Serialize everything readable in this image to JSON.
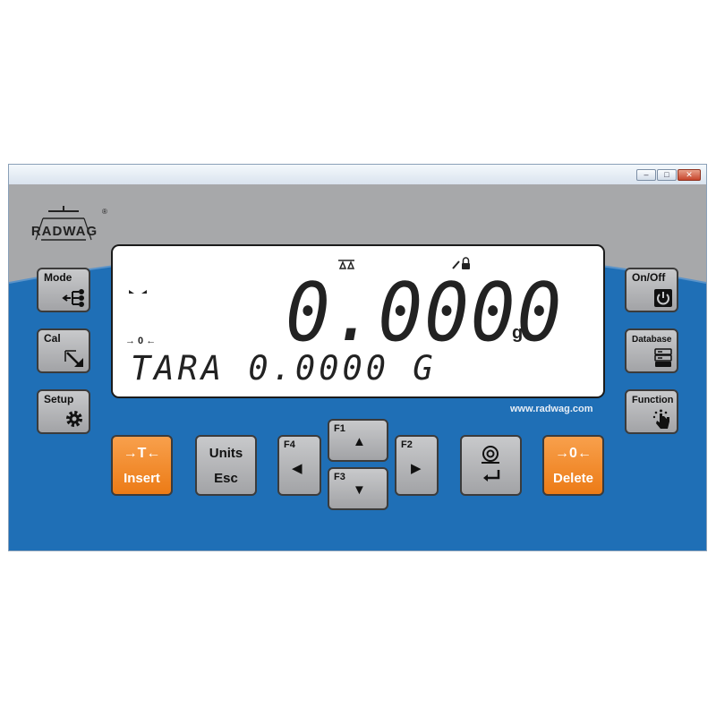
{
  "window": {
    "controls": {
      "minimize": "–",
      "maximize": "□",
      "close": "✕"
    }
  },
  "brand": {
    "name": "RADWAG",
    "registered": "®",
    "url": "www.radwag.com"
  },
  "display": {
    "weight": "0.0000",
    "unit": "g",
    "zero_indicator": "→ 0 ←",
    "tare_line": "TARA 0.0000 G",
    "indicators": [
      "stability-marker",
      "balance-icon",
      "wrench-lock-icon"
    ]
  },
  "side_keys": {
    "mode": "Mode",
    "cal": "Cal",
    "setup": "Setup",
    "onoff": "On/Off",
    "database": "Database",
    "function": "Function"
  },
  "bottom_keys": {
    "tare_top": "→T←",
    "tare_bottom": "Insert",
    "units_top": "Units",
    "units_bottom": "Esc",
    "f1": "F1",
    "f2": "F2",
    "f3": "F3",
    "f4": "F4",
    "zero_top": "→0←",
    "zero_bottom": "Delete"
  },
  "colors": {
    "accent_orange": "#ef8120",
    "panel_blue": "#1f6fb6",
    "panel_gray": "#a7a8aa"
  }
}
